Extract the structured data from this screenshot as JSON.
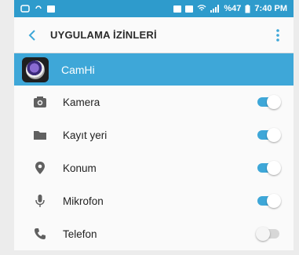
{
  "status_bar": {
    "right_text": "%47",
    "time": "7:40 PM",
    "colors": {
      "background": "#2e9bcc"
    }
  },
  "app_bar": {
    "title": "UYGULAMA İZİNLERİ",
    "back_icon": "chevron-left-icon",
    "menu_icon": "more-vert-icon"
  },
  "app": {
    "name": "CamHi",
    "icon": "camhi-app-icon",
    "header_color": "#3ea7d8"
  },
  "permissions": [
    {
      "label": "Kamera",
      "icon": "camera-icon",
      "enabled": true
    },
    {
      "label": "Kayıt yeri",
      "icon": "folder-icon",
      "enabled": true
    },
    {
      "label": "Konum",
      "icon": "location-pin-icon",
      "enabled": true
    },
    {
      "label": "Mikrofon",
      "icon": "microphone-icon",
      "enabled": true
    },
    {
      "label": "Telefon",
      "icon": "phone-icon",
      "enabled": false
    }
  ],
  "colors": {
    "accent": "#3ea7d8",
    "toggle_off": "#d7d7d7",
    "icon": "#606060"
  }
}
